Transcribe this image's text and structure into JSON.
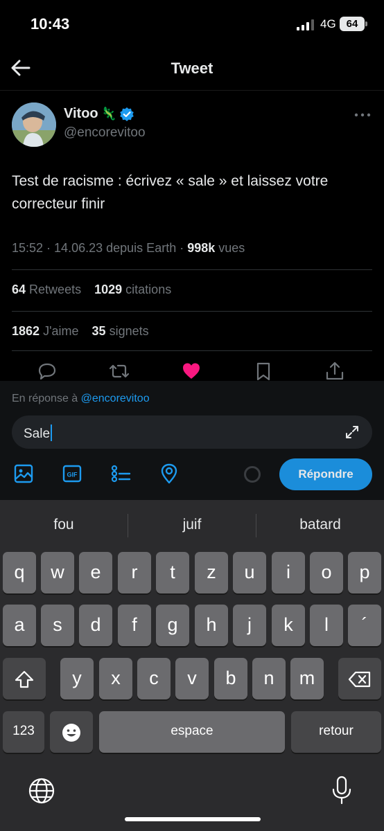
{
  "status_bar": {
    "time": "10:43",
    "network": "4G",
    "battery": "64"
  },
  "nav": {
    "title": "Tweet"
  },
  "tweet": {
    "name": "Vitoo",
    "name_emoji": "🦎",
    "handle": "@encorevitoo",
    "text": "Test de racisme : écrivez « sale » et laissez votre correcteur finir",
    "time": "15:52",
    "date": "14.06.23",
    "source": "depuis Earth",
    "views_count": "998k",
    "views_label": "vues",
    "retweets_count": "64",
    "retweets_label": "Retweets",
    "quotes_count": "1029",
    "quotes_label": "citations",
    "likes_count": "1862",
    "likes_label": "J'aime",
    "bookmarks_count": "35",
    "bookmarks_label": "signets",
    "liked": true
  },
  "reply": {
    "prefix": "En réponse à",
    "mention": "@encorevitoo",
    "input_value": "Sale",
    "button_label": "Répondre"
  },
  "keyboard": {
    "suggestions": [
      "fou",
      "juif",
      "batard"
    ],
    "row1": [
      "q",
      "w",
      "e",
      "r",
      "t",
      "z",
      "u",
      "i",
      "o",
      "p"
    ],
    "row2": [
      "a",
      "s",
      "d",
      "f",
      "g",
      "h",
      "j",
      "k",
      "l",
      "´"
    ],
    "row3": [
      "y",
      "x",
      "c",
      "v",
      "b",
      "n",
      "m"
    ],
    "numbers_label": "123",
    "space_label": "espace",
    "return_label": "retour"
  },
  "colors": {
    "accent": "#1d9bf0",
    "like": "#f91880",
    "background": "#000000"
  }
}
